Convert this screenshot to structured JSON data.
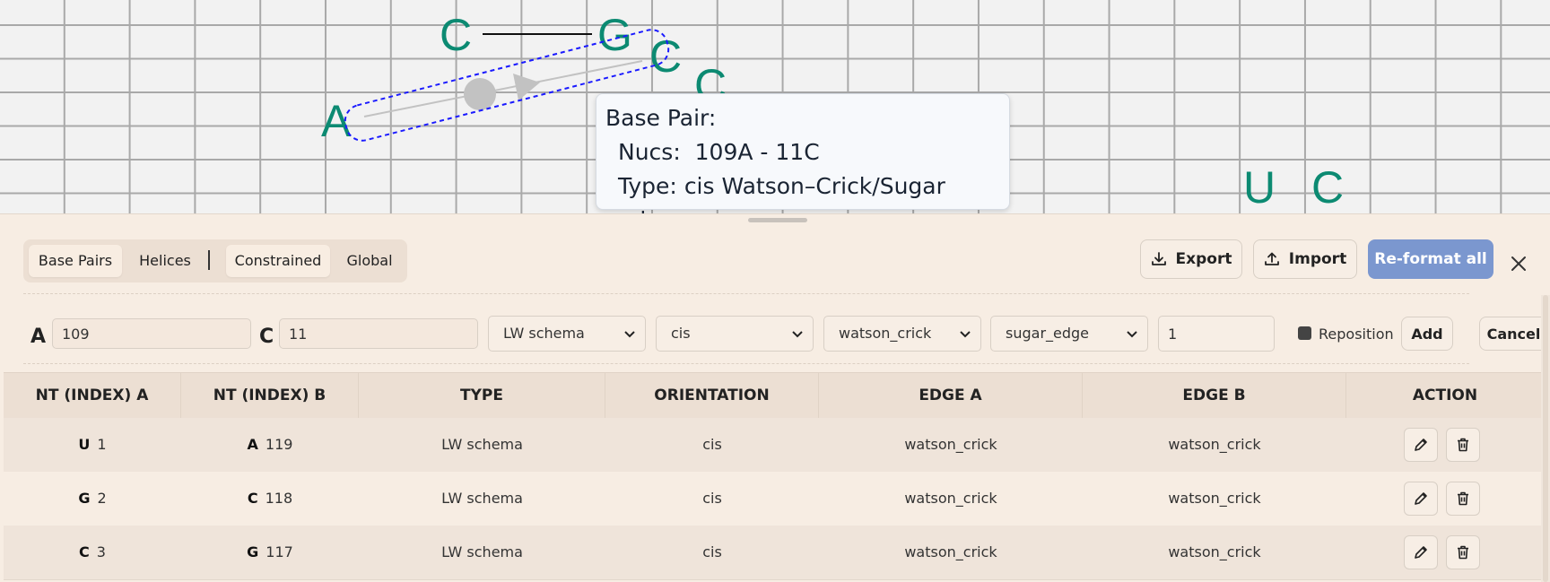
{
  "canvas": {
    "nucleotides": [
      "C",
      "G",
      "C",
      "A",
      "C",
      "U",
      "C"
    ]
  },
  "tooltip": {
    "title": "Base Pair:",
    "nucs_label": "Nucs:",
    "nucs_value": "109A - 11C",
    "type_label": "Type:",
    "type_value": "cis Watson–Crick/Sugar edge"
  },
  "toolbar": {
    "tabs": [
      "Base Pairs",
      "Helices",
      "Constrained",
      "Global"
    ],
    "export_label": "Export",
    "import_label": "Import",
    "reformat_label": "Re-format all"
  },
  "form": {
    "label_a": "A",
    "input_a": "109",
    "label_c": "C",
    "input_c": "11",
    "schema": "LW schema",
    "orientation": "cis",
    "edge_a": "watson_crick",
    "edge_b": "sugar_edge",
    "count": "1",
    "reposition_label": "Reposition",
    "add_label": "Add",
    "cancel_label": "Cancel"
  },
  "table": {
    "headers": [
      "NT (INDEX) A",
      "NT (INDEX) B",
      "TYPE",
      "ORIENTATION",
      "EDGE A",
      "EDGE B",
      "ACTION"
    ],
    "rows": [
      {
        "nt_a": "U",
        "idx_a": "1",
        "nt_b": "A",
        "idx_b": "119",
        "type": "LW schema",
        "orientation": "cis",
        "edge_a": "watson_crick",
        "edge_b": "watson_crick"
      },
      {
        "nt_a": "G",
        "idx_a": "2",
        "nt_b": "C",
        "idx_b": "118",
        "type": "LW schema",
        "orientation": "cis",
        "edge_a": "watson_crick",
        "edge_b": "watson_crick"
      },
      {
        "nt_a": "C",
        "idx_a": "3",
        "nt_b": "G",
        "idx_b": "117",
        "type": "LW schema",
        "orientation": "cis",
        "edge_a": "watson_crick",
        "edge_b": "watson_crick"
      }
    ]
  },
  "colors": {
    "nucleotide": "#0c8a72",
    "accent": "#7b97cf",
    "selection": "#1a1aff"
  }
}
